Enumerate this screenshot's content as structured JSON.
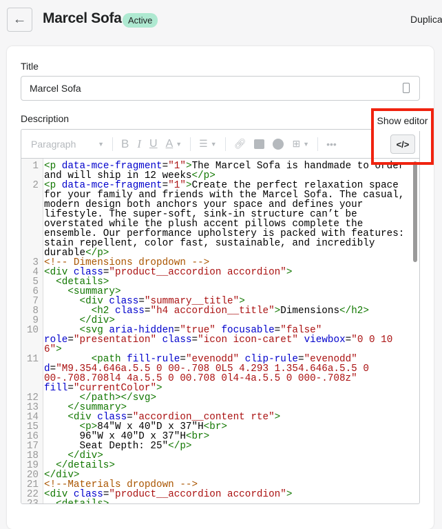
{
  "header": {
    "title": "Marcel Sofa",
    "status": "Active",
    "duplicate_label": "Duplica"
  },
  "form": {
    "title_label": "Title",
    "title_value": "Marcel Sofa",
    "description_label": "Description"
  },
  "toolbar": {
    "format": "Paragraph",
    "bold": "B",
    "italic": "I",
    "underline": "U",
    "color": "A",
    "more": "•••",
    "code_button": "</>",
    "tooltip": "Show editor"
  },
  "colors": {
    "highlight": "#f0230f",
    "badge": "#aee9d1",
    "tag": "#117700",
    "attribute": "#0000cc",
    "string": "#aa1111",
    "comment": "#aa5500"
  },
  "code_rows": [
    {
      "n": "1",
      "tokens": [
        [
          "t",
          "<p"
        ],
        [
          "x",
          " "
        ],
        [
          "a",
          "data-mce-fragment"
        ],
        [
          "x",
          "="
        ],
        [
          "s",
          "\"1\""
        ],
        [
          "t",
          ">"
        ],
        [
          "x",
          "The Marcel Sofa is handmade to order"
        ]
      ]
    },
    {
      "n": "",
      "tokens": [
        [
          "x",
          "and will ship in 12 weeks"
        ],
        [
          "t",
          "</p>"
        ]
      ]
    },
    {
      "n": "2",
      "tokens": [
        [
          "t",
          "<p"
        ],
        [
          "x",
          " "
        ],
        [
          "a",
          "data-mce-fragment"
        ],
        [
          "x",
          "="
        ],
        [
          "s",
          "\"1\""
        ],
        [
          "t",
          ">"
        ],
        [
          "x",
          "Create the perfect relaxation space"
        ]
      ]
    },
    {
      "n": "",
      "tokens": [
        [
          "x",
          "for your family and friends with the Marcel Sofa. The casual,"
        ]
      ]
    },
    {
      "n": "",
      "tokens": [
        [
          "x",
          "modern design both anchors your space and defines your"
        ]
      ]
    },
    {
      "n": "",
      "tokens": [
        [
          "x",
          "lifestyle. The super-soft, sink-in structure can’t be"
        ]
      ]
    },
    {
      "n": "",
      "tokens": [
        [
          "x",
          "overstated while the plush accent pillows complete the"
        ]
      ]
    },
    {
      "n": "",
      "tokens": [
        [
          "x",
          "ensemble. Our performance upholstery is packed with features:"
        ]
      ]
    },
    {
      "n": "",
      "tokens": [
        [
          "x",
          "stain repellent, color fast, sustainable, and incredibly"
        ]
      ]
    },
    {
      "n": "",
      "tokens": [
        [
          "x",
          "durable"
        ],
        [
          "t",
          "</p>"
        ]
      ]
    },
    {
      "n": "3",
      "tokens": [
        [
          "c",
          "<!-- Dimensions dropdown -->"
        ]
      ]
    },
    {
      "n": "4",
      "tokens": [
        [
          "t",
          "<div"
        ],
        [
          "x",
          " "
        ],
        [
          "a",
          "class"
        ],
        [
          "x",
          "="
        ],
        [
          "s",
          "\"product__accordion accordion\""
        ],
        [
          "t",
          ">"
        ]
      ]
    },
    {
      "n": "5",
      "tokens": [
        [
          "x",
          "  "
        ],
        [
          "t",
          "<details>"
        ]
      ]
    },
    {
      "n": "6",
      "tokens": [
        [
          "x",
          "    "
        ],
        [
          "t",
          "<summary>"
        ]
      ]
    },
    {
      "n": "7",
      "tokens": [
        [
          "x",
          "      "
        ],
        [
          "t",
          "<div"
        ],
        [
          "x",
          " "
        ],
        [
          "a",
          "class"
        ],
        [
          "x",
          "="
        ],
        [
          "s",
          "\"summary__title\""
        ],
        [
          "t",
          ">"
        ]
      ]
    },
    {
      "n": "8",
      "tokens": [
        [
          "x",
          "        "
        ],
        [
          "t",
          "<h2"
        ],
        [
          "x",
          " "
        ],
        [
          "a",
          "class"
        ],
        [
          "x",
          "="
        ],
        [
          "s",
          "\"h4 accordion__title\""
        ],
        [
          "t",
          ">"
        ],
        [
          "x",
          "Dimensions"
        ],
        [
          "t",
          "</h2>"
        ]
      ]
    },
    {
      "n": "9",
      "tokens": [
        [
          "x",
          "      "
        ],
        [
          "t",
          "</div>"
        ]
      ]
    },
    {
      "n": "10",
      "tokens": [
        [
          "x",
          "      "
        ],
        [
          "t",
          "<svg"
        ],
        [
          "x",
          " "
        ],
        [
          "a",
          "aria-hidden"
        ],
        [
          "x",
          "="
        ],
        [
          "s",
          "\"true\""
        ],
        [
          "x",
          " "
        ],
        [
          "a",
          "focusable"
        ],
        [
          "x",
          "="
        ],
        [
          "s",
          "\"false\""
        ]
      ]
    },
    {
      "n": "",
      "tokens": [
        [
          "a",
          "role"
        ],
        [
          "x",
          "="
        ],
        [
          "s",
          "\"presentation\""
        ],
        [
          "x",
          " "
        ],
        [
          "a",
          "class"
        ],
        [
          "x",
          "="
        ],
        [
          "s",
          "\"icon icon-caret\""
        ],
        [
          "x",
          " "
        ],
        [
          "a",
          "viewbox"
        ],
        [
          "x",
          "="
        ],
        [
          "s",
          "\"0 0 10"
        ]
      ]
    },
    {
      "n": "",
      "tokens": [
        [
          "s",
          "6\""
        ],
        [
          "t",
          ">"
        ]
      ]
    },
    {
      "n": "11",
      "tokens": [
        [
          "x",
          "        "
        ],
        [
          "t",
          "<path"
        ],
        [
          "x",
          " "
        ],
        [
          "a",
          "fill-rule"
        ],
        [
          "x",
          "="
        ],
        [
          "s",
          "\"evenodd\""
        ],
        [
          "x",
          " "
        ],
        [
          "a",
          "clip-rule"
        ],
        [
          "x",
          "="
        ],
        [
          "s",
          "\"evenodd\""
        ]
      ]
    },
    {
      "n": "",
      "tokens": [
        [
          "a",
          "d"
        ],
        [
          "x",
          "="
        ],
        [
          "s",
          "\"M9.354.646a.5.5 0 00-.708 0L5 4.293 1.354.646a.5.5 0"
        ]
      ]
    },
    {
      "n": "",
      "tokens": [
        [
          "s",
          "00-.708.708l4 4a.5.5 0 00.708 0l4-4a.5.5 0 000-.708z\""
        ]
      ]
    },
    {
      "n": "",
      "tokens": [
        [
          "a",
          "fill"
        ],
        [
          "x",
          "="
        ],
        [
          "s",
          "\"currentColor\""
        ],
        [
          "t",
          ">"
        ]
      ]
    },
    {
      "n": "12",
      "tokens": [
        [
          "x",
          "      "
        ],
        [
          "t",
          "</path></svg>"
        ]
      ]
    },
    {
      "n": "13",
      "tokens": [
        [
          "x",
          "    "
        ],
        [
          "t",
          "</summary>"
        ]
      ]
    },
    {
      "n": "14",
      "tokens": [
        [
          "x",
          "    "
        ],
        [
          "t",
          "<div"
        ],
        [
          "x",
          " "
        ],
        [
          "a",
          "class"
        ],
        [
          "x",
          "="
        ],
        [
          "s",
          "\"accordion__content rte\""
        ],
        [
          "t",
          ">"
        ]
      ]
    },
    {
      "n": "15",
      "tokens": [
        [
          "x",
          "      "
        ],
        [
          "t",
          "<p>"
        ],
        [
          "x",
          "84\"W x 40\"D x 37\"H"
        ],
        [
          "t",
          "<br>"
        ]
      ]
    },
    {
      "n": "16",
      "tokens": [
        [
          "x",
          "      96\"W x 40\"D x 37\"H"
        ],
        [
          "t",
          "<br>"
        ]
      ]
    },
    {
      "n": "17",
      "tokens": [
        [
          "x",
          "      Seat Depth: 25\""
        ],
        [
          "t",
          "</p>"
        ]
      ]
    },
    {
      "n": "18",
      "tokens": [
        [
          "x",
          "    "
        ],
        [
          "t",
          "</div>"
        ]
      ]
    },
    {
      "n": "19",
      "tokens": [
        [
          "x",
          "  "
        ],
        [
          "t",
          "</details>"
        ]
      ]
    },
    {
      "n": "20",
      "tokens": [
        [
          "t",
          "</div>"
        ]
      ]
    },
    {
      "n": "21",
      "tokens": [
        [
          "c",
          "<!--Materials dropdown -->"
        ]
      ]
    },
    {
      "n": "22",
      "tokens": [
        [
          "t",
          "<div"
        ],
        [
          "x",
          " "
        ],
        [
          "a",
          "class"
        ],
        [
          "x",
          "="
        ],
        [
          "s",
          "\"product__accordion accordion\""
        ],
        [
          "t",
          ">"
        ]
      ]
    },
    {
      "n": "23",
      "tokens": [
        [
          "x",
          "  "
        ],
        [
          "t",
          "<details>"
        ]
      ]
    }
  ]
}
